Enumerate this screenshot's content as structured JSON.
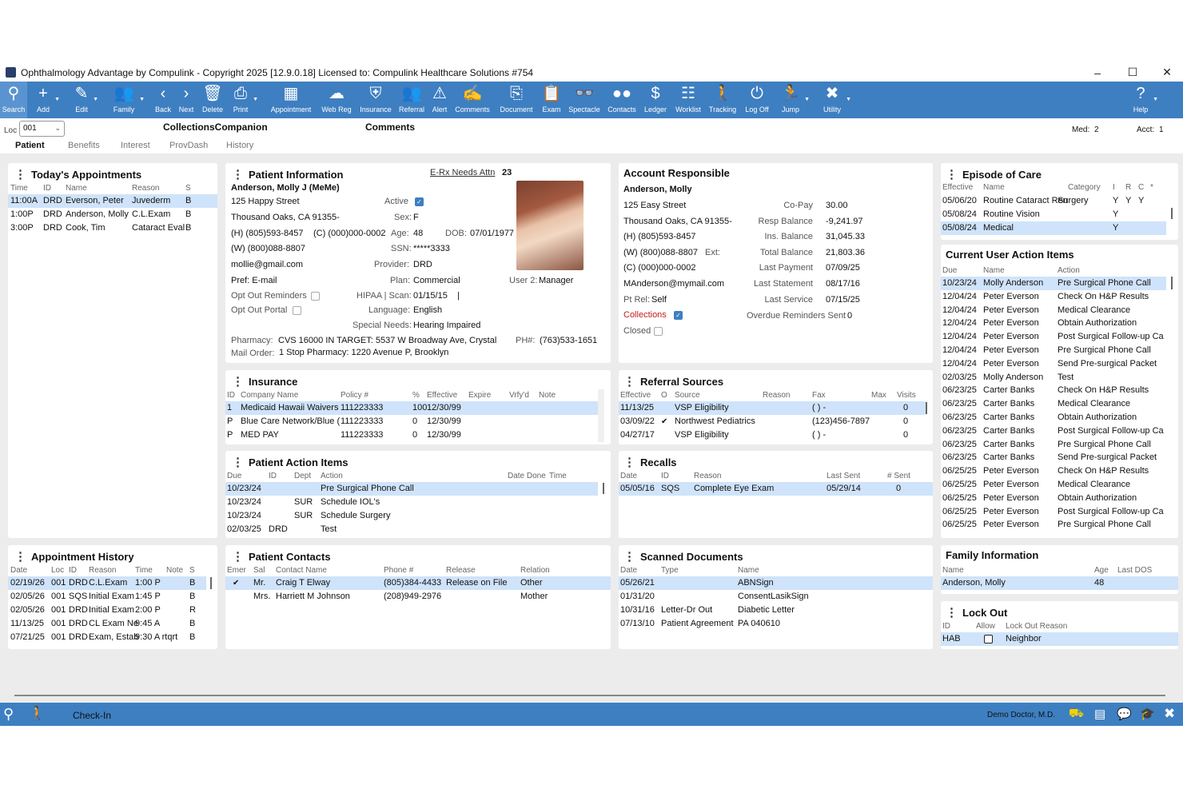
{
  "window": {
    "title": "Ophthalmology Advantage by Compulink - Copyright 2025 [12.9.0.18] Licensed to: Compulink Healthcare Solutions #754",
    "minimize": "–",
    "maximize": "☐",
    "close": "✕"
  },
  "toolbar": {
    "search": "Search",
    "add": "Add",
    "edit": "Edit",
    "family": "Family",
    "back": "Back",
    "next": "Next",
    "delete": "Delete",
    "print": "Print",
    "appointment": "Appointment",
    "webreg": "Web Reg",
    "insurance": "Insurance",
    "referral": "Referral",
    "alert": "Alert",
    "comments": "Comments",
    "document": "Document",
    "exam": "Exam",
    "spectacle": "Spectacle",
    "contacts": "Contacts",
    "ledger": "Ledger",
    "worklist": "Worklist",
    "tracking": "Tracking",
    "logoff": "Log Off",
    "jump": "Jump",
    "utility": "Utility",
    "help": "Help"
  },
  "subheader": {
    "loc_label": "Loc",
    "loc_value": "001",
    "companion": "CollectionsCompanion",
    "comments": "Comments",
    "med_label": "Med:",
    "med_value": "2",
    "acct_label": "Acct:",
    "acct_value": "1",
    "tabs": [
      "Patient",
      "Benefits",
      "Interest",
      "ProvDash",
      "History"
    ]
  },
  "todays": {
    "title": "Today's Appointments",
    "cols": [
      "Time",
      "ID",
      "Name",
      "Reason",
      "S"
    ],
    "rows": [
      [
        "11:00A",
        "DRD",
        "Everson, Peter",
        "Juvederm",
        "B"
      ],
      [
        "1:00P",
        "DRD",
        "Anderson, Molly",
        "C.L.Exam",
        "B"
      ],
      [
        "3:00P",
        "DRD",
        "Cook, Tim",
        "Cataract Eval",
        "B"
      ]
    ]
  },
  "patient": {
    "title": "Patient Information",
    "erx": "E-Rx Needs Attn",
    "erx_count": "23",
    "name": "Anderson, Molly J (MeMe)",
    "street": "125 Happy Street",
    "city": "Thousand Oaks, CA  91355-",
    "home": "(H) (805)593-8457",
    "cell": "(C) (000)000-0002",
    "work": "(W) (800)088-8807",
    "email": "mollie@gmail.com",
    "pref": "Pref:  E-mail",
    "opt_rem": "Opt Out Reminders",
    "opt_portal": "Opt Out Portal",
    "active_lbl": "Active",
    "sex_lbl": "Sex:",
    "sex": "F",
    "age_lbl": "Age:",
    "age": "48",
    "dob_lbl": "DOB:",
    "dob": "07/01/1977",
    "ssn_lbl": "SSN:",
    "ssn": "*****3333",
    "provider_lbl": "Provider:",
    "provider": "DRD",
    "plan_lbl": "Plan:",
    "plan": "Commercial",
    "user2_lbl": "User 2:",
    "user2": "Manager",
    "hipaa_lbl": "HIPAA | Scan:",
    "hipaa": "01/15/15",
    "hipaa_sep": "|",
    "lang_lbl": "Language:",
    "lang": "English",
    "sneeds_lbl": "Special Needs:",
    "sneeds": "Hearing Impaired",
    "pharm_lbl": "Pharmacy:",
    "pharm": "CVS 16000 IN TARGET: 5537 W Broadway Ave, Crystal",
    "ph_lbl": "PH#:",
    "ph": "(763)533-1651",
    "mail_lbl": "Mail Order:",
    "mail": "1 Stop Pharmacy: 1220 Avenue P, Brooklyn"
  },
  "account": {
    "title": "Account Responsible",
    "name": "Anderson, Molly",
    "street": "125 Easy Street",
    "city": "Thousand Oaks, CA  91355-",
    "home": "(H) (805)593-8457",
    "work": "(W) (800)088-8807",
    "ext": "Ext:",
    "cell": "(C) (000)000-0002",
    "email": "MAnderson@mymail.com",
    "ptrel_lbl": "Pt Rel:",
    "ptrel": "Self",
    "collections": "Collections",
    "closed": "Closed",
    "labels": [
      "Co-Pay",
      "Resp Balance",
      "Ins. Balance",
      "Total Balance",
      "Last Payment",
      "Last Statement",
      "Last Service"
    ],
    "values": [
      "30.00",
      "-9,241.97",
      "31,045.33",
      "21,803.36",
      "07/09/25",
      "08/17/16",
      "07/15/25"
    ],
    "overdue_lbl": "Overdue Reminders Sent",
    "overdue": "0"
  },
  "episode": {
    "title": "Episode of Care",
    "cols": [
      "Effective",
      "Name",
      "Category",
      "I",
      "R",
      "C",
      "*"
    ],
    "rows": [
      [
        "05/06/20",
        "Routine Cataract Ren",
        "Surgery",
        "Y",
        "Y",
        "Y"
      ],
      [
        "05/08/24",
        "Routine Vision",
        "",
        "Y",
        "",
        ""
      ],
      [
        "05/08/24",
        "Medical",
        "",
        "Y",
        "",
        ""
      ]
    ]
  },
  "user_actions": {
    "title": "Current User Action Items",
    "cols": [
      "Due",
      "Name",
      "Action"
    ],
    "rows": [
      [
        "10/23/24",
        "Molly Anderson",
        "Pre Surgical Phone Call"
      ],
      [
        "12/04/24",
        "Peter Everson",
        "Check On H&P Results"
      ],
      [
        "12/04/24",
        "Peter Everson",
        "Medical Clearance"
      ],
      [
        "12/04/24",
        "Peter Everson",
        "Obtain Authorization"
      ],
      [
        "12/04/24",
        "Peter Everson",
        "Post Surgical Follow-up Ca"
      ],
      [
        "12/04/24",
        "Peter Everson",
        "Pre Surgical Phone Call"
      ],
      [
        "12/04/24",
        "Peter Everson",
        "Send Pre-surgical Packet"
      ],
      [
        "02/03/25",
        "Molly Anderson",
        "Test"
      ],
      [
        "06/23/25",
        "Carter Banks",
        "Check On H&P Results"
      ],
      [
        "06/23/25",
        "Carter Banks",
        "Medical Clearance"
      ],
      [
        "06/23/25",
        "Carter Banks",
        "Obtain Authorization"
      ],
      [
        "06/23/25",
        "Carter Banks",
        "Post Surgical Follow-up Ca"
      ],
      [
        "06/23/25",
        "Carter Banks",
        "Pre Surgical Phone Call"
      ],
      [
        "06/23/25",
        "Carter Banks",
        "Send Pre-surgical Packet"
      ],
      [
        "06/25/25",
        "Peter Everson",
        "Check On H&P Results"
      ],
      [
        "06/25/25",
        "Peter Everson",
        "Medical Clearance"
      ],
      [
        "06/25/25",
        "Peter Everson",
        "Obtain Authorization"
      ],
      [
        "06/25/25",
        "Peter Everson",
        "Post Surgical Follow-up Ca"
      ],
      [
        "06/25/25",
        "Peter Everson",
        "Pre Surgical Phone Call"
      ]
    ]
  },
  "insurance": {
    "title": "Insurance",
    "cols": [
      "ID",
      "Company Name",
      "Policy #",
      "%",
      "Effective",
      "Expire",
      "Vrfy'd",
      "Note"
    ],
    "rows": [
      [
        "1",
        "Medicaid Hawaii Waivers",
        "111223333",
        "100",
        "12/30/99"
      ],
      [
        "P",
        "Blue Care Network/Blue (",
        "111223333",
        "0",
        "12/30/99"
      ],
      [
        "P",
        "MED PAY",
        "111223333",
        "0",
        "12/30/99"
      ]
    ]
  },
  "referral": {
    "title": "Referral Sources",
    "cols": [
      "Effective",
      "O",
      "Source",
      "Reason",
      "Fax",
      "Max",
      "Visits"
    ],
    "rows": [
      [
        "11/13/25",
        "",
        "VSP Eligibility",
        "",
        "(  )  -",
        "0"
      ],
      [
        "03/09/22",
        "✔",
        "Northwest Pediatrics",
        "",
        "(123)456-7897",
        "0"
      ],
      [
        "04/27/17",
        "",
        "VSP Eligibility",
        "",
        "(  )  -",
        "0"
      ]
    ]
  },
  "pactions": {
    "title": "Patient Action Items",
    "cols": [
      "Due",
      "ID",
      "Dept",
      "Action",
      "Date Done",
      "Time"
    ],
    "rows": [
      [
        "10/23/24",
        "",
        "",
        "Pre Surgical Phone Call"
      ],
      [
        "10/23/24",
        "",
        "SUR",
        "Schedule IOL's"
      ],
      [
        "10/23/24",
        "",
        "SUR",
        "Schedule Surgery"
      ],
      [
        "02/03/25",
        "DRD",
        "",
        "Test"
      ]
    ]
  },
  "recalls": {
    "title": "Recalls",
    "cols": [
      "Date",
      "ID",
      "Reason",
      "Last Sent",
      "# Sent"
    ],
    "rows": [
      [
        "05/05/16",
        "SQS",
        "Complete Eye Exam",
        "05/29/14",
        "0"
      ]
    ]
  },
  "appthist": {
    "title": "Appointment History",
    "cols": [
      "Date",
      "Loc",
      "ID",
      "Reason",
      "Time",
      "Note",
      "S"
    ],
    "rows": [
      [
        "02/19/26",
        "001",
        "DRD",
        "C.L.Exam",
        "1:00 P",
        "B"
      ],
      [
        "02/05/26",
        "001",
        "SQS",
        "Initial Exam",
        "1:45 P",
        "B"
      ],
      [
        "02/05/26",
        "001",
        "DRD",
        "Initial Exam",
        "2:00 P",
        "R"
      ],
      [
        "11/13/25",
        "001",
        "DRD",
        "CL Exam Ne",
        "9:45 A",
        "B"
      ],
      [
        "07/21/25",
        "001",
        "DRD",
        "Exam, Estab",
        "9:30 A rtqrt",
        "B"
      ]
    ]
  },
  "contacts": {
    "title": "Patient Contacts",
    "cols": [
      "Emer",
      "Sal",
      "Contact Name",
      "Phone #",
      "Release",
      "Relation"
    ],
    "rows": [
      [
        "✔",
        "Mr.",
        "Craig T Elway",
        "(805)384-4433",
        "Release on File",
        "Other"
      ],
      [
        "",
        "Mrs.",
        "Harriett M Johnson",
        "(208)949-2976",
        "",
        "Mother"
      ]
    ]
  },
  "scanned": {
    "title": "Scanned Documents",
    "cols": [
      "Date",
      "Type",
      "Name"
    ],
    "rows": [
      [
        "05/26/21",
        "",
        "ABNSign"
      ],
      [
        "01/31/20",
        "",
        "ConsentLasikSign"
      ],
      [
        "10/31/16",
        "Letter-Dr Out",
        "Diabetic Letter"
      ],
      [
        "07/13/10",
        "Patient Agreement",
        "PA 040610"
      ]
    ]
  },
  "family": {
    "title": "Family Information",
    "cols": [
      "Name",
      "Age",
      "Last DOS"
    ],
    "rows": [
      [
        "Anderson, Molly",
        "48",
        ""
      ]
    ]
  },
  "lockout": {
    "title": "Lock Out",
    "cols": [
      "ID",
      "Allow",
      "Lock Out Reason"
    ],
    "rows": [
      [
        "HAB",
        "",
        "Neighbor"
      ]
    ]
  },
  "status": {
    "checkin": "Check-In",
    "doctor": "Demo Doctor, M.D."
  }
}
